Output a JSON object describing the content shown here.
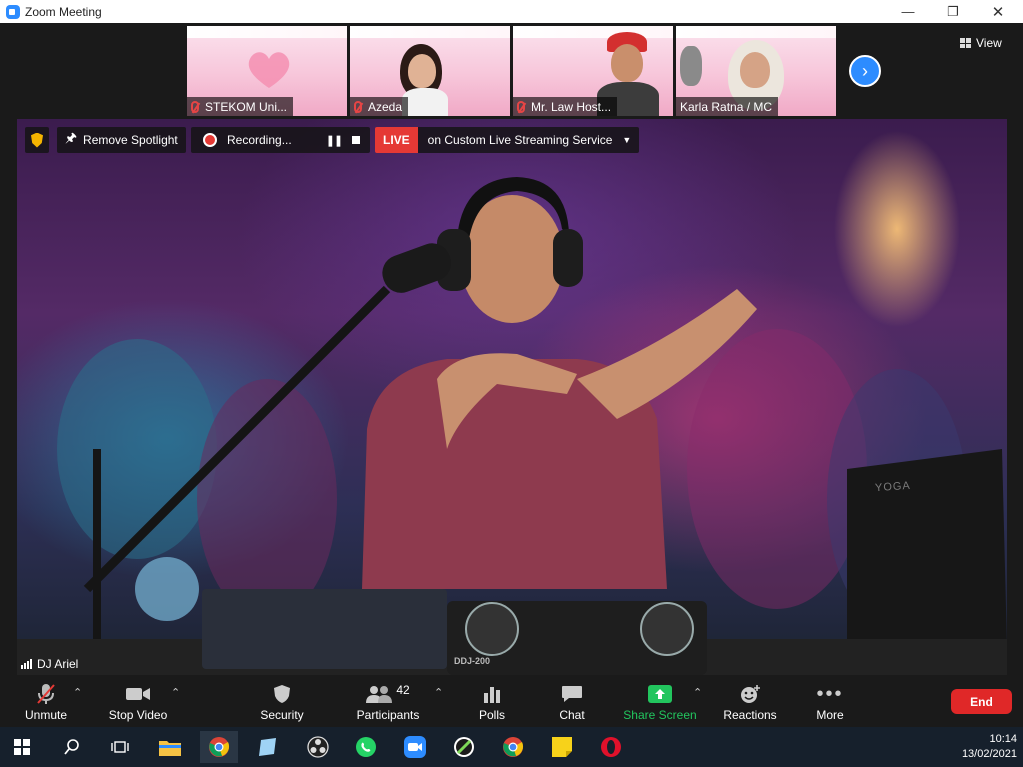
{
  "window": {
    "title": "Zoom Meeting"
  },
  "top_strip": {
    "thumbnails": [
      {
        "name": "STEKOM Uni..."
      },
      {
        "name": "Azeda"
      },
      {
        "name": "Mr. Law Host..."
      },
      {
        "name": "Karla Ratna / MC"
      }
    ],
    "view_label": "View"
  },
  "video_bar": {
    "remove_spotlight": "Remove Spotlight",
    "recording": "Recording...",
    "live": "LIVE",
    "streaming": "on Custom Live Streaming Service"
  },
  "main_video": {
    "speaker": "DJ Ariel",
    "laptop_brand": "YOGA",
    "mixer_brand": "DDJ-200"
  },
  "toolbar": {
    "unmute": "Unmute",
    "stop_video": "Stop Video",
    "security": "Security",
    "participants": "Participants",
    "participants_count": "42",
    "polls": "Polls",
    "chat": "Chat",
    "share_screen": "Share Screen",
    "reactions": "Reactions",
    "more": "More",
    "end": "End"
  },
  "taskbar": {
    "time": "10:14",
    "date": "13/02/2021"
  },
  "colors": {
    "zoom_blue": "#2D8CFF",
    "share_green": "#22C55E",
    "end_red": "#E02828",
    "live_red": "#E53935"
  }
}
